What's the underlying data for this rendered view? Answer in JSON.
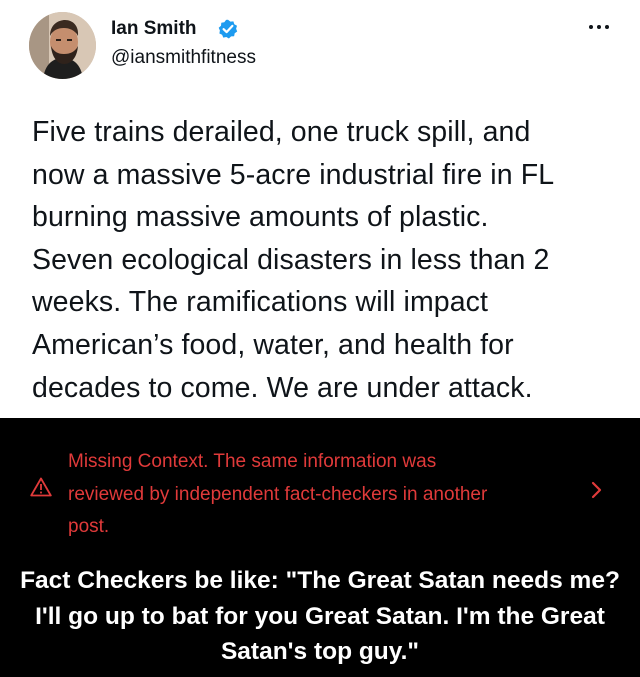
{
  "tweet": {
    "author_name": "Ian Smith",
    "author_handle": "@iansmithfitness",
    "verified_icon": "verified-badge-icon",
    "more_icon": "more-options-icon",
    "text_lines": [
      "Five trains derailed, one truck spill, and",
      "now a massive 5-acre industrial fire in FL",
      "burning massive amounts of plastic.",
      "Seven ecological disasters in less than 2",
      "weeks. The ramifications will impact",
      "American’s food, water, and health for",
      "decades to come. We are under attack."
    ]
  },
  "fact_check": {
    "icon": "warning-triangle-icon",
    "lines": [
      "Missing Context. The same information was",
      "reviewed by independent fact-checkers in another",
      "post."
    ],
    "color": "#e03a3a",
    "chevron_icon": "chevron-right-icon"
  },
  "caption": {
    "lines": [
      "Fact Checkers be like: \"The Great Satan needs me?",
      "I'll go up to bat for you Great Satan. I'm the Great",
      "Satan's top guy.\""
    ]
  },
  "colors": {
    "tweet_background": "#ffffff",
    "page_background": "#000000",
    "verified_blue": "#1d9bf0"
  }
}
